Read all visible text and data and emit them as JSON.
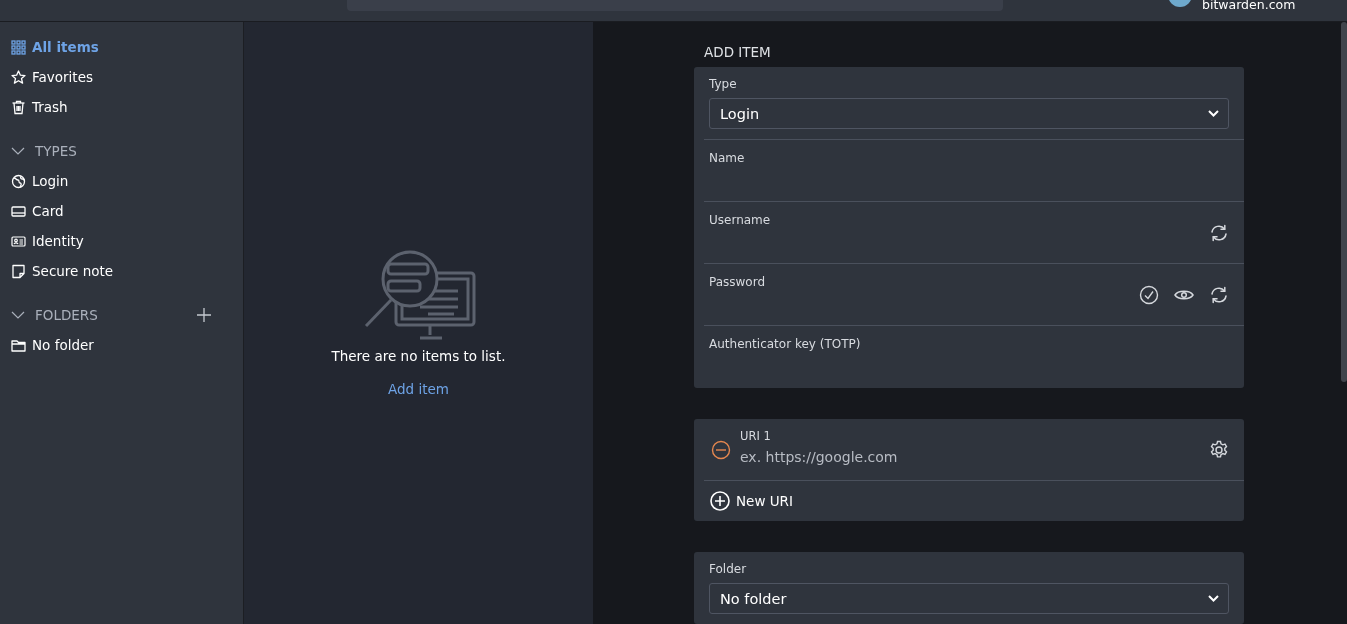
{
  "header": {
    "account": {
      "email": "bitwarden.com"
    }
  },
  "sidebar": {
    "groups": [
      {
        "kind": "filters",
        "items": [
          {
            "label": "All items",
            "kind": "grid",
            "selected": true
          },
          {
            "label": "Favorites",
            "kind": "star",
            "selected": false
          },
          {
            "label": "Trash",
            "kind": "trash",
            "selected": false
          }
        ]
      },
      {
        "kind": "section",
        "title": "TYPES",
        "expanded": true,
        "items": [
          {
            "label": "Login",
            "kind": "globe",
            "selected": false
          },
          {
            "label": "Card",
            "kind": "card",
            "selected": false
          },
          {
            "label": "Identity",
            "kind": "id",
            "selected": false
          },
          {
            "label": "Secure note",
            "kind": "note",
            "selected": false
          }
        ]
      },
      {
        "kind": "section",
        "title": "FOLDERS",
        "expanded": true,
        "addable": true,
        "items": [
          {
            "label": "No folder",
            "kind": "folder",
            "selected": false
          }
        ]
      }
    ]
  },
  "list": {
    "message": "There are no items to list.",
    "link": "Add item"
  },
  "add_item": {
    "heading": "ADD ITEM",
    "type_field": {
      "label": "Type",
      "value": "Login"
    },
    "fields": [
      {
        "label": "Name"
      },
      {
        "label": "Username",
        "actions": [
          {
            "kind": "generate"
          }
        ]
      },
      {
        "label": "Password",
        "actions": [
          {
            "kind": "check"
          },
          {
            "kind": "view"
          },
          {
            "kind": "generate"
          }
        ]
      },
      {
        "label": "Authenticator key (TOTP)"
      }
    ],
    "uris": [
      {
        "label": "URI 1",
        "placeholder": "ex. https://google.com"
      }
    ],
    "new_uri": "New URI",
    "folder_field": {
      "label": "Folder",
      "value": "No folder"
    }
  }
}
